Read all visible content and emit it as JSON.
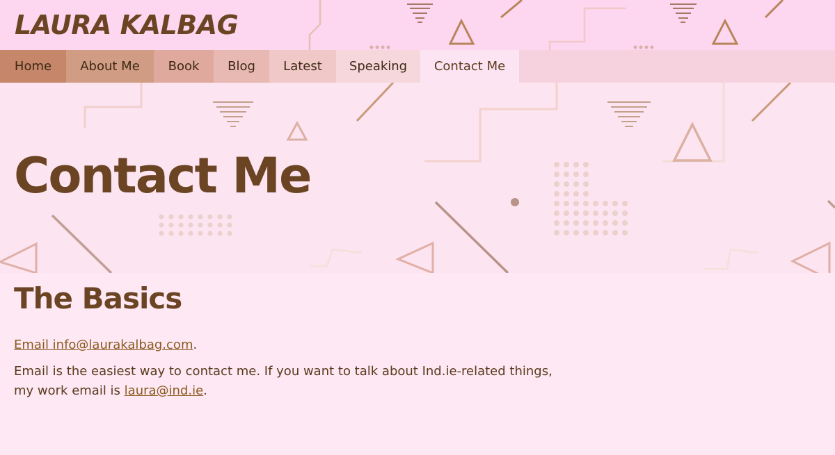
{
  "site": {
    "title": "LAURA KALBAG"
  },
  "nav": {
    "items": [
      {
        "label": "Home",
        "color": "#c5866a"
      },
      {
        "label": "About Me",
        "color": "#d19c84"
      },
      {
        "label": "Book",
        "color": "#dfaa9d"
      },
      {
        "label": "Blog",
        "color": "#e8b9b2"
      },
      {
        "label": "Latest",
        "color": "#f0c8c8"
      },
      {
        "label": "Speaking",
        "color": "#f6d8dc"
      },
      {
        "label": "Contact Me",
        "color": "#fde4f2"
      }
    ],
    "active": "Contact Me"
  },
  "hero": {
    "title": "Contact Me"
  },
  "main": {
    "heading": "The Basics",
    "email_link": "Email info@laurakalbag.com",
    "email_suffix": ".",
    "para2_text": "Email is the easiest way to contact me. If you want to talk about Ind.ie-related things, my work email is ",
    "work_email_link": "laura@ind.ie",
    "para2_suffix": "."
  },
  "colors": {
    "brand_brown": "#6b4423",
    "link": "#8a5a1e",
    "background": "#fde8f4",
    "header_pink": "#fdd7ef"
  }
}
